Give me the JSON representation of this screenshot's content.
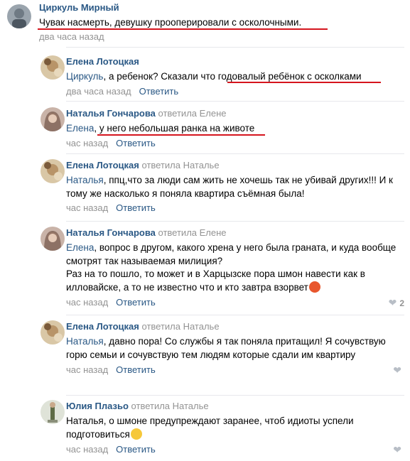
{
  "comments": [
    {
      "author": "Циркуль Мирный",
      "replied_to": "",
      "addressee": "",
      "text": "Чувак насмерть, девушку прооперировали с осколочными.",
      "time": "два часа назад",
      "reply_label": "",
      "likes": ""
    },
    {
      "author": "Елена Лотоцкая",
      "replied_to": "",
      "addressee": "Циркуль",
      "text": ", а ребенок? Сказали что годовалый ребёнок с осколками",
      "time": "два часа назад",
      "reply_label": "Ответить",
      "likes": ""
    },
    {
      "author": "Наталья Гончарова",
      "replied_to": "ответила Елене",
      "addressee": "Елена",
      "text": ", у него небольшая ранка на животе",
      "time": "час назад",
      "reply_label": "Ответить",
      "likes": ""
    },
    {
      "author": "Елена Лотоцкая",
      "replied_to": "ответила Наталье",
      "addressee": "Наталья",
      "text": ", ппц,что за люди сам жить не хочешь так не убивай других!!! И к тому же насколько я поняла квартира съёмная была!",
      "time": "час назад",
      "reply_label": "Ответить",
      "likes": ""
    },
    {
      "author": "Наталья Гончарова",
      "replied_to": "ответила Елене",
      "addressee": "Елена",
      "text": ", вопрос в другом, какого хрена у него была граната, и куда вообще смотрят так называемая милиция?",
      "text2": "Раз на то пошло, то может и в Харцызске пора шмон навести как в илловайске, а то не известно что и кто завтра взорвет",
      "time": "час назад",
      "reply_label": "Ответить",
      "likes": "2"
    },
    {
      "author": "Елена Лотоцкая",
      "replied_to": "ответила Наталье",
      "addressee": "Наталья",
      "text": ", давно пора! Со службы я так поняла притащил! Я сочувствую горю семьи и сочувствую тем людям которые сдали им квартиру",
      "time": "час назад",
      "reply_label": "Ответить",
      "likes": ""
    },
    {
      "author": "Юлия Плазьо",
      "replied_to": "ответила Наталье",
      "addressee": "",
      "text": "Наталья, о шмоне предупреждают заранее, чтоб идиоты успели подготовиться",
      "time": "час назад",
      "reply_label": "Ответить",
      "likes": ""
    }
  ],
  "icons": {
    "like": "heart-icon",
    "angry_emoji": "angry-face-icon",
    "smirk_emoji": "smirking-face-icon"
  },
  "colors": {
    "link": "#2a5885",
    "muted": "#939393",
    "underline": "#d5151e",
    "divider": "#e7e8ec"
  }
}
